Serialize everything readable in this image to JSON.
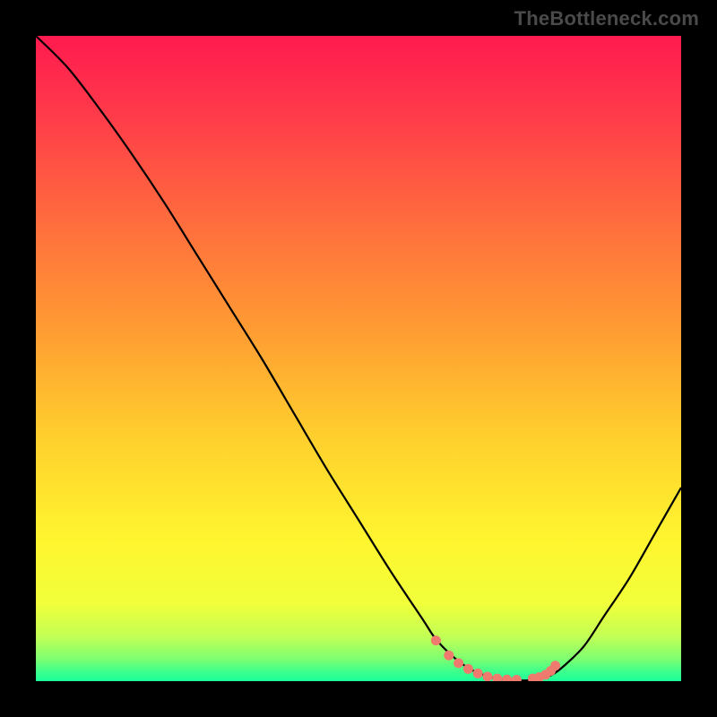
{
  "watermark": "TheBottleneck.com",
  "chart_data": {
    "type": "line",
    "title": "",
    "xlabel": "",
    "ylabel": "",
    "xlim": [
      0,
      100
    ],
    "ylim": [
      0,
      100
    ],
    "grid": false,
    "legend": null,
    "series": [
      {
        "name": "bottleneck-curve",
        "stroke": "#000000",
        "x": [
          0,
          5,
          10,
          15,
          20,
          25,
          30,
          35,
          40,
          45,
          50,
          55,
          60,
          62,
          65,
          68,
          72,
          75,
          78,
          80,
          82,
          85,
          88,
          92,
          96,
          100
        ],
        "y": [
          100,
          95,
          88.5,
          81.5,
          74,
          66,
          58,
          50,
          41.5,
          33,
          25,
          17,
          9.5,
          6.5,
          3.5,
          1.5,
          0.3,
          0.1,
          0.3,
          1,
          2.5,
          5.5,
          10,
          16,
          23,
          30
        ]
      }
    ],
    "markers": {
      "name": "highlight-dots",
      "fill": "#ef7b6f",
      "x": [
        62,
        64,
        65.5,
        67,
        68.5,
        70,
        71.5,
        73,
        74.5,
        77,
        78,
        79,
        79.8,
        80.5
      ],
      "y": [
        6.3,
        4.0,
        2.8,
        1.9,
        1.2,
        0.7,
        0.4,
        0.25,
        0.2,
        0.4,
        0.6,
        1.0,
        1.6,
        2.4
      ]
    },
    "background_gradient": {
      "type": "vertical",
      "stops": [
        {
          "offset": 0.0,
          "color": "#ff1a4f"
        },
        {
          "offset": 0.12,
          "color": "#ff3a4a"
        },
        {
          "offset": 0.28,
          "color": "#ff6a3e"
        },
        {
          "offset": 0.45,
          "color": "#ff9a33"
        },
        {
          "offset": 0.62,
          "color": "#ffcf2d"
        },
        {
          "offset": 0.78,
          "color": "#fff52f"
        },
        {
          "offset": 0.88,
          "color": "#f0ff3a"
        },
        {
          "offset": 0.93,
          "color": "#c3ff55"
        },
        {
          "offset": 0.965,
          "color": "#7fff70"
        },
        {
          "offset": 0.985,
          "color": "#3dff8c"
        },
        {
          "offset": 1.0,
          "color": "#1aff9a"
        }
      ]
    }
  }
}
